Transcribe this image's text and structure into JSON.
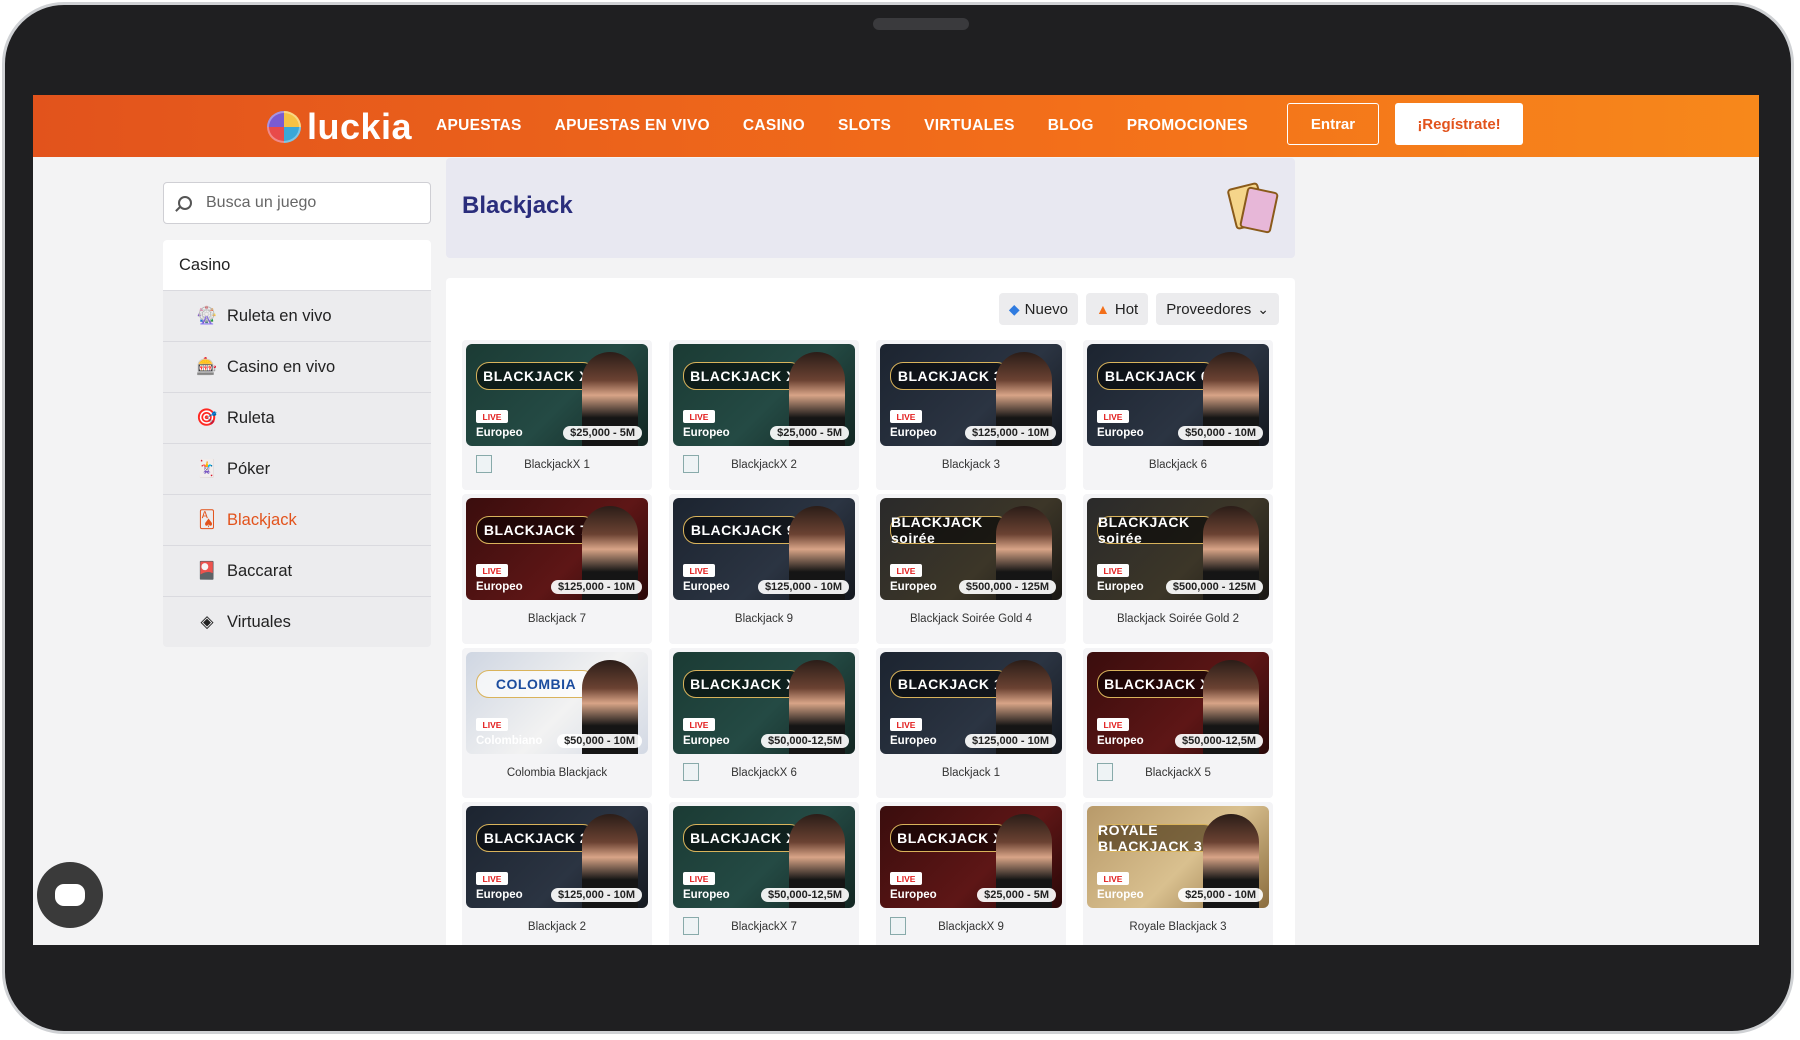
{
  "header": {
    "logo": "luckia",
    "nav": [
      "APUESTAS",
      "APUESTAS EN VIVO",
      "CASINO",
      "SLOTS",
      "VIRTUALES",
      "BLOG",
      "PROMOCIONES"
    ],
    "login_label": "Entrar",
    "register_label": "¡Regístrate!"
  },
  "search": {
    "placeholder": "Busca un juego"
  },
  "sidebar": {
    "heading": "Casino",
    "items": [
      {
        "label": "Ruleta en vivo",
        "icon": "live-roulette-icon"
      },
      {
        "label": "Casino en vivo",
        "icon": "live-casino-icon"
      },
      {
        "label": "Ruleta",
        "icon": "roulette-icon"
      },
      {
        "label": "Póker",
        "icon": "poker-icon"
      },
      {
        "label": "Blackjack",
        "icon": "blackjack-icon",
        "active": true
      },
      {
        "label": "Baccarat",
        "icon": "baccarat-icon"
      },
      {
        "label": "Virtuales",
        "icon": "virtual-icon"
      }
    ]
  },
  "page": {
    "title": "Blackjack"
  },
  "filters": {
    "new": "Nuevo",
    "hot": "Hot",
    "providers": "Proveedores"
  },
  "colors": {
    "brand": "#e2531c",
    "title": "#2a2d7c"
  },
  "games": [
    {
      "name": "BlackjackX 1",
      "thumb_title": "BLACKJACK X",
      "live": "LIVE",
      "type": "Europeo",
      "bet": "$25,000 - 5M",
      "style": "green",
      "broken_icon": true
    },
    {
      "name": "BlackjackX 2",
      "thumb_title": "BLACKJACK X",
      "live": "LIVE",
      "type": "Europeo",
      "bet": "$25,000 - 5M",
      "style": "green",
      "broken_icon": true
    },
    {
      "name": "Blackjack 3",
      "thumb_title": "BLACKJACK 3",
      "live": "LIVE",
      "type": "Europeo",
      "bet": "$125,000 - 10M",
      "style": "dark"
    },
    {
      "name": "Blackjack 6",
      "thumb_title": "BLACKJACK 6",
      "live": "LIVE",
      "type": "Europeo",
      "bet": "$50,000 - 10M",
      "style": "dark"
    },
    {
      "name": "Blackjack 7",
      "thumb_title": "BLACKJACK 7",
      "live": "LIVE",
      "type": "Europeo",
      "bet": "$125,000 - 10M",
      "style": "red"
    },
    {
      "name": "Blackjack 9",
      "thumb_title": "BLACKJACK 9",
      "live": "LIVE",
      "type": "Europeo",
      "bet": "$125,000 - 10M",
      "style": "dark"
    },
    {
      "name": "Blackjack Soirée Gold 4",
      "thumb_title": "BLACKJACK soirée",
      "live": "LIVE",
      "type": "Europeo",
      "bet": "$500,000 - 125M",
      "style": "gold"
    },
    {
      "name": "Blackjack Soirée Gold 2",
      "thumb_title": "BLACKJACK soirée",
      "live": "LIVE",
      "type": "Europeo",
      "bet": "$500,000 - 125M",
      "style": "gold"
    },
    {
      "name": "Colombia Blackjack",
      "thumb_title": "COLOMBIA",
      "live": "LIVE",
      "type": "Colombiano",
      "bet": "$50,000 - 10M",
      "style": "colom"
    },
    {
      "name": "BlackjackX 6",
      "thumb_title": "BLACKJACK X",
      "live": "LIVE",
      "type": "Europeo",
      "bet": "$50,000-12,5M",
      "style": "green",
      "broken_icon": true
    },
    {
      "name": "Blackjack 1",
      "thumb_title": "BLACKJACK 1",
      "live": "LIVE",
      "type": "Europeo",
      "bet": "$125,000 - 10M",
      "style": "dark"
    },
    {
      "name": "BlackjackX 5",
      "thumb_title": "BLACKJACK X",
      "live": "LIVE",
      "type": "Europeo",
      "bet": "$50,000-12,5M",
      "style": "red",
      "broken_icon": true
    },
    {
      "name": "Blackjack 2",
      "thumb_title": "BLACKJACK 2",
      "live": "LIVE",
      "type": "Europeo",
      "bet": "$125,000 - 10M",
      "style": "dark"
    },
    {
      "name": "BlackjackX 7",
      "thumb_title": "BLACKJACK X",
      "live": "LIVE",
      "type": "Europeo",
      "bet": "$50,000-12,5M",
      "style": "green",
      "broken_icon": true
    },
    {
      "name": "BlackjackX 9",
      "thumb_title": "BLACKJACK X",
      "live": "LIVE",
      "type": "Europeo",
      "bet": "$25,000 - 5M",
      "style": "red",
      "broken_icon": true
    },
    {
      "name": "Royale Blackjack 3",
      "thumb_title": "ROYALE BLACKJACK 3",
      "live": "LIVE",
      "type": "Europeo",
      "bet": "$25,000 - 10M",
      "style": "royal"
    }
  ]
}
